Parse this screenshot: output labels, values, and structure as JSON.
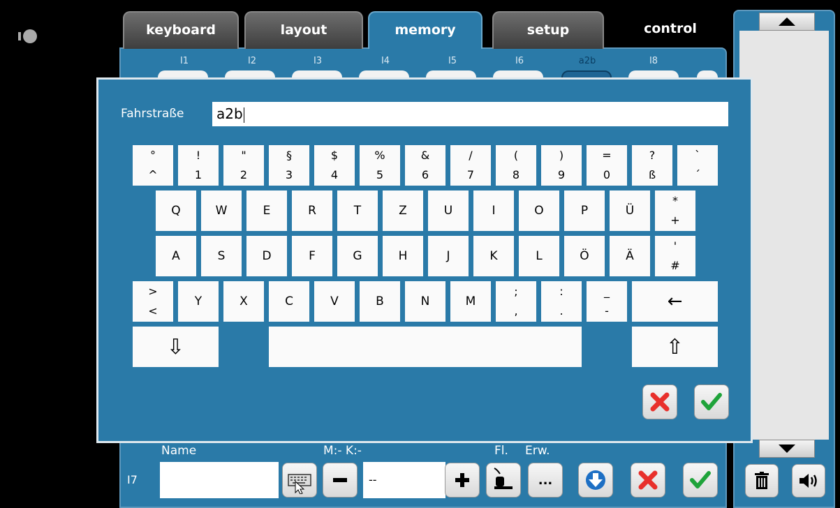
{
  "tabs": [
    {
      "label": "keyboard",
      "state": "inactive"
    },
    {
      "label": "layout",
      "state": "inactive"
    },
    {
      "label": "memory",
      "state": "active"
    },
    {
      "label": "setup",
      "state": "inactive"
    },
    {
      "label": "control",
      "state": "plain"
    }
  ],
  "memory_slots": [
    "I1",
    "I2",
    "I3",
    "I4",
    "I5",
    "I6",
    "a2b",
    "I8"
  ],
  "selected_slot": "a2b",
  "dialog": {
    "field_label": "Fahrstraße",
    "field_value": "a2b",
    "keyboard_rows": [
      [
        {
          "top": "°",
          "bottom": "^"
        },
        {
          "top": "!",
          "bottom": "1"
        },
        {
          "top": "\"",
          "bottom": "2"
        },
        {
          "top": "§",
          "bottom": "3"
        },
        {
          "top": "$",
          "bottom": "4"
        },
        {
          "top": "%",
          "bottom": "5"
        },
        {
          "top": "&",
          "bottom": "6"
        },
        {
          "top": "/",
          "bottom": "7"
        },
        {
          "top": "(",
          "bottom": "8"
        },
        {
          "top": ")",
          "bottom": "9"
        },
        {
          "top": "=",
          "bottom": "0"
        },
        {
          "top": "?",
          "bottom": "ß"
        },
        {
          "top": "`",
          "bottom": "´"
        }
      ],
      [
        {
          "label": "Q"
        },
        {
          "label": "W"
        },
        {
          "label": "E"
        },
        {
          "label": "R"
        },
        {
          "label": "T"
        },
        {
          "label": "Z"
        },
        {
          "label": "U"
        },
        {
          "label": "I"
        },
        {
          "label": "O"
        },
        {
          "label": "P"
        },
        {
          "label": "Ü"
        },
        {
          "top": "*",
          "bottom": "+"
        }
      ],
      [
        {
          "label": "A"
        },
        {
          "label": "S"
        },
        {
          "label": "D"
        },
        {
          "label": "F"
        },
        {
          "label": "G"
        },
        {
          "label": "H"
        },
        {
          "label": "J"
        },
        {
          "label": "K"
        },
        {
          "label": "L"
        },
        {
          "label": "Ö"
        },
        {
          "label": "Ä"
        },
        {
          "top": "'",
          "bottom": "#"
        }
      ],
      [
        {
          "top": ">",
          "bottom": "<"
        },
        {
          "label": "Y"
        },
        {
          "label": "X"
        },
        {
          "label": "C"
        },
        {
          "label": "V"
        },
        {
          "label": "B"
        },
        {
          "label": "N"
        },
        {
          "label": "M"
        },
        {
          "top": ";",
          "bottom": ","
        },
        {
          "top": ":",
          "bottom": "."
        },
        {
          "top": "_",
          "bottom": "-"
        },
        {
          "label": "←",
          "name": "backspace"
        }
      ],
      [
        {
          "label": "⇩",
          "name": "hide-keyboard"
        },
        {
          "label": "",
          "name": "space"
        },
        {
          "label": "⇧",
          "name": "shift"
        }
      ]
    ]
  },
  "bottom_bar": {
    "name_label": "Name",
    "mk_label": "M:- K:-",
    "fl_label": "Fl.",
    "erw_label": "Erw.",
    "row_id": "I7",
    "mk_value": "--",
    "more_label": "..."
  },
  "colors": {
    "panel": "#2a7aa8",
    "cancel_red": "#e8302b",
    "ok_green": "#1fa33a",
    "down_blue": "#1d6fc4"
  }
}
